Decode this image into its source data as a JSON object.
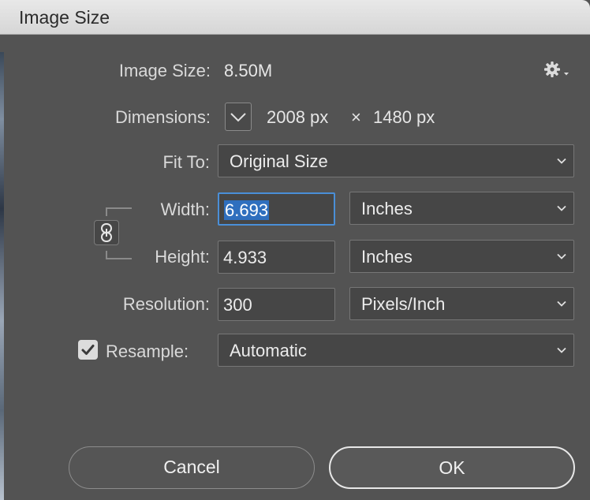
{
  "window": {
    "title": "Image Size"
  },
  "image_size": {
    "label": "Image Size:",
    "value": "8.50M"
  },
  "dimensions": {
    "label": "Dimensions:",
    "width": "2008 px",
    "times": "×",
    "height": "1480 px"
  },
  "fit_to": {
    "label": "Fit To:",
    "value": "Original Size"
  },
  "width": {
    "label": "Width:",
    "value": "6.693",
    "unit": "Inches"
  },
  "height": {
    "label": "Height:",
    "value": "4.933",
    "unit": "Inches"
  },
  "resolution": {
    "label": "Resolution:",
    "value": "300",
    "unit": "Pixels/Inch"
  },
  "resample": {
    "label": "Resample:",
    "checked": true,
    "value": "Automatic"
  },
  "buttons": {
    "cancel": "Cancel",
    "ok": "OK"
  },
  "icons": {
    "settings": "gear-icon",
    "dimensions_toggle": "chevron-down-icon",
    "constrain": "chain-link-icon",
    "checkbox": "checkmark-icon"
  },
  "colors": {
    "dialog_bg": "#535353",
    "field_bg": "#464646",
    "selection": "#2f6fbe",
    "focus_ring": "#4a8fd8"
  }
}
